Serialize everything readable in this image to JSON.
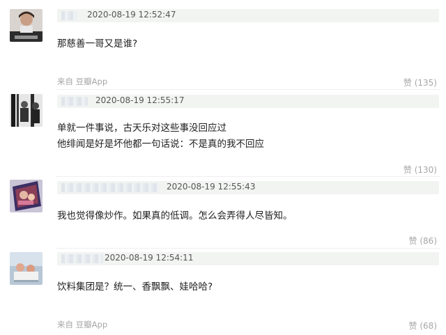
{
  "comments": [
    {
      "time": "2020-08-19 12:52:47",
      "lines": [
        "那慈善一哥又是谁?"
      ],
      "source": "来自 豆瓣App",
      "like": "赞 (135)",
      "avatar_icon": "user-avatar-icon"
    },
    {
      "time": "2020-08-19 12:55:17",
      "lines": [
        "单就一件事说，古天乐对这些事没回应过",
        "他绯闻是好是坏他都一句话说：不是真的我不回应"
      ],
      "source": "",
      "like": "赞 (130)",
      "avatar_icon": "user-avatar-icon"
    },
    {
      "time": "2020-08-19 12:55:43",
      "lines": [
        "我也觉得像炒作。如果真的低调。怎么会弄得人尽皆知。"
      ],
      "source": "",
      "like": "赞 (86)",
      "avatar_icon": "user-avatar-icon"
    },
    {
      "time": "2020-08-19 12:54:11",
      "lines": [
        "饮料集团是？统一、香飘飘、娃哈哈?"
      ],
      "source": "来自 豆瓣App",
      "like": "赞 (68)",
      "avatar_icon": "user-avatar-icon"
    }
  ]
}
